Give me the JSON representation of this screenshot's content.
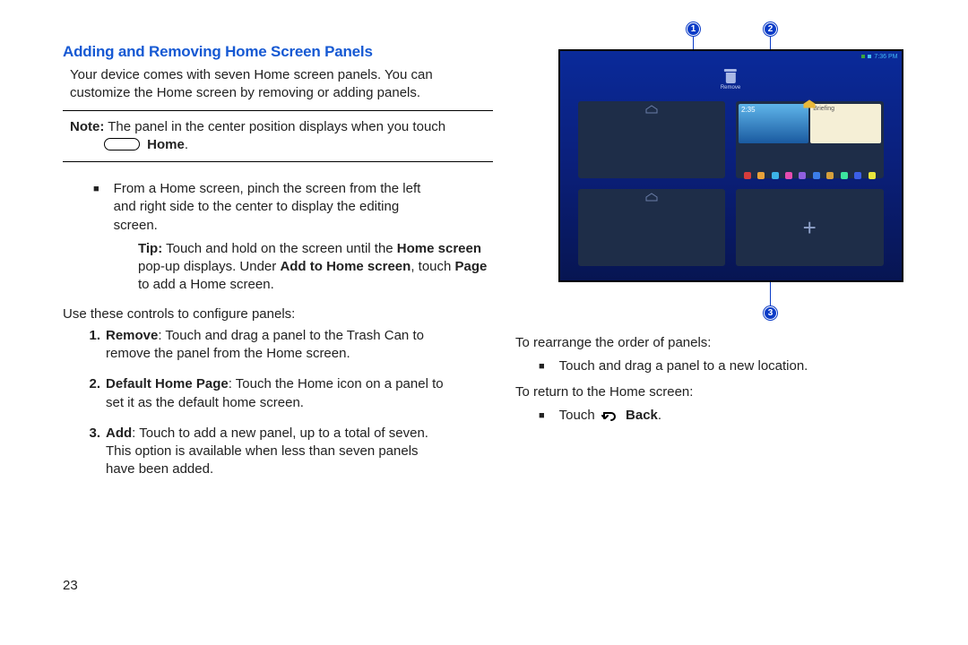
{
  "title": "Adding and Removing Home Screen Panels",
  "intro_line1": "Your device comes with seven Home screen panels. You can",
  "intro_line2": "customize the Home screen by removing or adding panels.",
  "note_prefix": "Note:",
  "note_body_1": " The panel in the center position displays when you touch",
  "note_home": "Home",
  "note_period": ".",
  "bullet1_l1": "From a Home screen, pinch the screen from the left",
  "bullet1_l2": "and right side to the center to display the editing",
  "bullet1_l3": "screen.",
  "tip_prefix": "Tip:",
  "tip_l1a": " Touch and hold on the screen until the ",
  "tip_l1b": "Home screen",
  "tip_l2a": "pop-up displays. Under ",
  "tip_l2b": "Add to Home screen",
  "tip_l2c": ", touch ",
  "tip_l2d": "Page",
  "tip_l3": "to add a Home screen.",
  "use_controls": "Use these controls to configure panels:",
  "li1_num": "1.",
  "li1_b": "Remove",
  "li1_t1": ": Touch and drag a panel to the Trash Can to",
  "li1_t2": "remove the panel from the Home screen.",
  "li2_num": "2.",
  "li2_b": "Default Home Page",
  "li2_t1": ": Touch the Home icon on a panel to",
  "li2_t2": "set it as the default home screen.",
  "li3_num": "3.",
  "li3_b": "Add",
  "li3_t1": ": Touch to add a new panel, up to a total of seven.",
  "li3_t2": "This option is available when less than seven panels",
  "li3_t3": "have been added.",
  "page_num": "23",
  "device": {
    "status_time": "7:36 PM",
    "remove_label": "Remove",
    "widget_time": "2:35",
    "widget_briefing": "Briefing",
    "plus": "+",
    "app_colors": [
      "#d63c3c",
      "#e8a23a",
      "#3cb4e8",
      "#e54cb0",
      "#8f5fe0",
      "#3c7de8",
      "#d6a03c",
      "#3ce5a0",
      "#3c5fe8",
      "#e8e53c"
    ]
  },
  "callouts": {
    "c1": "1",
    "c2": "2",
    "c3": "3"
  },
  "right": {
    "rearrange": "To rearrange the order of panels:",
    "rearrange_b": "Touch and drag a panel to a new location.",
    "return": "To return to the Home screen:",
    "return_touch": "Touch ",
    "return_back": "Back",
    "return_period": "."
  }
}
